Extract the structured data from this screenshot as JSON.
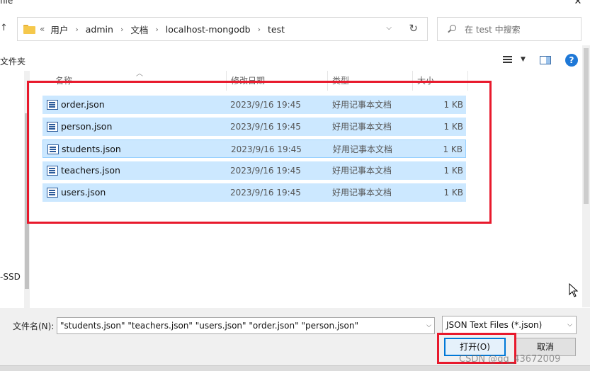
{
  "window": {
    "title": "file",
    "close": "✕"
  },
  "address": {
    "prefix": "«",
    "crumbs": [
      "用户",
      "admin",
      "文档",
      "localhost-mongodb",
      "test"
    ],
    "separator": "›"
  },
  "search": {
    "placeholder": "在 test 中搜索"
  },
  "toolbar": {
    "new_folder": "文件夹",
    "help": "?"
  },
  "nav": {
    "drive_label": "-SSD"
  },
  "columns": {
    "name": "名称",
    "date": "修改日期",
    "type": "类型",
    "size": "大小"
  },
  "files": [
    {
      "name": "order.json",
      "date": "2023/9/16 19:45",
      "type": "好用记事本文档",
      "size": "1 KB"
    },
    {
      "name": "person.json",
      "date": "2023/9/16 19:45",
      "type": "好用记事本文档",
      "size": "1 KB"
    },
    {
      "name": "students.json",
      "date": "2023/9/16 19:45",
      "type": "好用记事本文档",
      "size": "1 KB"
    },
    {
      "name": "teachers.json",
      "date": "2023/9/16 19:45",
      "type": "好用记事本文档",
      "size": "1 KB"
    },
    {
      "name": "users.json",
      "date": "2023/9/16 19:45",
      "type": "好用记事本文档",
      "size": "1 KB"
    }
  ],
  "footer": {
    "filename_label": "文件名(N):",
    "filename_value": "\"students.json\" \"teachers.json\" \"users.json\" \"order.json\" \"person.json\"",
    "filetype_value": "JSON Text Files (*.json)",
    "open_label": "打开(O)",
    "cancel_label": "取消"
  },
  "watermark": "CSDN @qq_43672009",
  "colors": {
    "selection": "#cce8ff",
    "highlight_box": "#e8192c",
    "accent": "#0078d7"
  }
}
